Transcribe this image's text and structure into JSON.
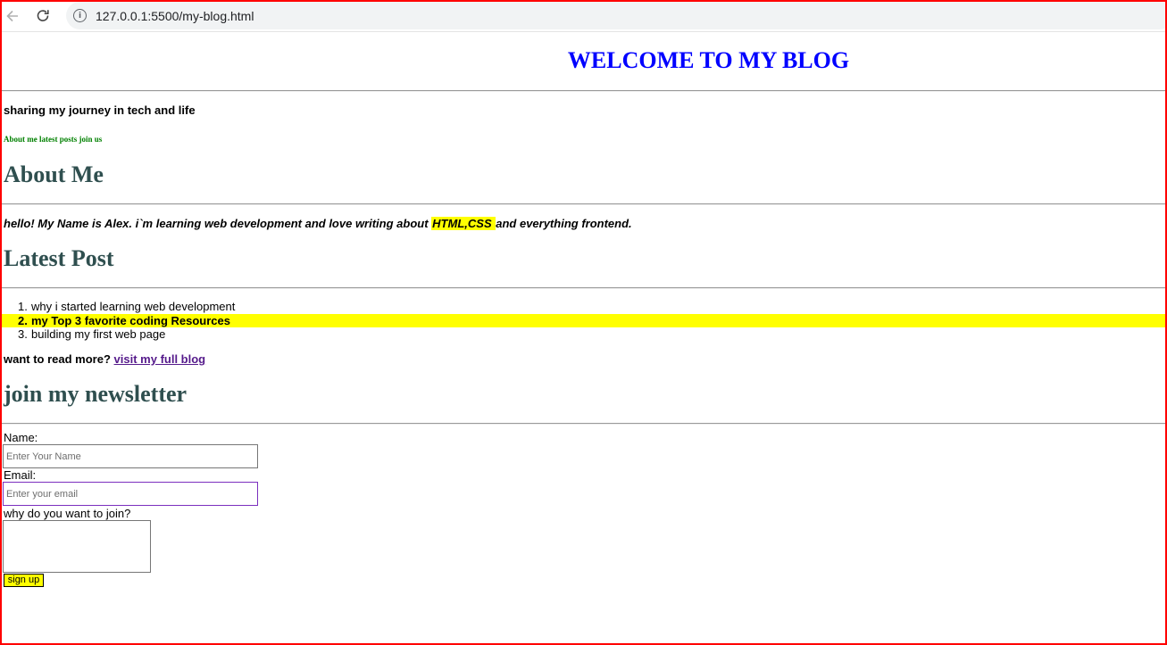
{
  "browser": {
    "url": "127.0.0.1:5500/my-blog.html",
    "info_icon": "i"
  },
  "header": {
    "title": "WELCOME TO MY BLOG",
    "tagline": "sharing my journey in tech and life",
    "nav": "About me latest posts join us"
  },
  "about": {
    "heading": "About Me",
    "text_before": "hello! My Name is Alex. i`m learning web development and love writing about ",
    "highlight": "HTML,CSS ",
    "text_after": "and everything frontend."
  },
  "posts": {
    "heading": "Latest Post",
    "items": [
      {
        "num": "1.",
        "title": "why i started learning web development"
      },
      {
        "num": "2.",
        "title": "my Top 3 favorite coding Resources"
      },
      {
        "num": "3.",
        "title": "building my first web page"
      }
    ],
    "read_more_text": "want to read more?",
    "read_more_link": "visit my full blog"
  },
  "newsletter": {
    "heading": "join my newsletter",
    "name_label": "Name:",
    "name_placeholder": "Enter Your Name",
    "email_label": "Email:",
    "email_placeholder": "Enter your email",
    "reason_label": "why do you want to join?",
    "submit_label": "sign up"
  },
  "colors": {
    "title": "#0000ff",
    "headings": "#2f4f4f",
    "nav_links": "#008000",
    "highlight": "#ffff00",
    "link": "#551a8b",
    "frame": "#ff0000"
  }
}
